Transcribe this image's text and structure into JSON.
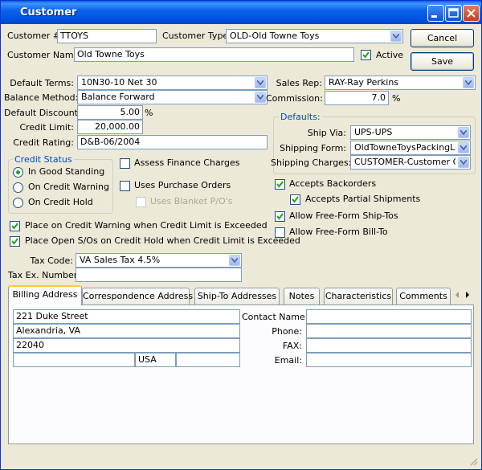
{
  "window": {
    "title": "Customer"
  },
  "header": {
    "customer_no_label": "Customer #:",
    "customer_no": "TTOYS",
    "customer_type_label": "Customer Type:",
    "customer_type": "OLD-Old Towne Toys",
    "customer_name_label": "Customer Name:",
    "customer_name": "Old Towne Toys",
    "active_label": "Active",
    "active": true
  },
  "buttons": {
    "cancel": "Cancel",
    "save": "Save"
  },
  "terms": {
    "default_terms_label": "Default Terms:",
    "default_terms": "10N30-10 Net 30",
    "balance_method_label": "Balance Method:",
    "balance_method": "Balance Forward",
    "default_discount_label": "Default Discount:",
    "default_discount": "5.00",
    "percent": "%",
    "credit_limit_label": "Credit Limit:",
    "credit_limit": "20,000.00",
    "credit_rating_label": "Credit Rating:",
    "credit_rating": "D&B-06/2004"
  },
  "sales": {
    "sales_rep_label": "Sales Rep:",
    "sales_rep": "RAY-Ray Perkins",
    "commission_label": "Commission:",
    "commission": "7.0",
    "percent": "%"
  },
  "defaults": {
    "title": "Defaults:",
    "ship_via_label": "Ship Via:",
    "ship_via": "UPS-UPS",
    "shipping_form_label": "Shipping Form:",
    "shipping_form": "OldTowneToysPackingList",
    "shipping_charges_label": "Shipping Charges:",
    "shipping_charges": "CUSTOMER-Customer Charge"
  },
  "credit_status": {
    "title": "Credit Status",
    "options": [
      "In Good Standing",
      "On Credit Warning",
      "On Credit Hold"
    ],
    "selected": 0
  },
  "options": {
    "assess_finance_charges": "Assess Finance Charges",
    "uses_purchase_orders": "Uses Purchase Orders",
    "uses_blanket_pos": "Uses Blanket P/O's",
    "accepts_backorders": "Accepts Backorders",
    "accepts_partial_shipments": "Accepts Partial Shipments",
    "allow_freeform_shipto": "Allow Free-Form Ship-Tos",
    "allow_freeform_billto": "Allow Free-Form Bill-To",
    "credit_warning_label": "Place on Credit Warning when Credit Limit is Exceeded",
    "credit_hold_label": "Place Open S/Os on Credit Hold when Credit Limit is Exceeded"
  },
  "tax": {
    "tax_code_label": "Tax Code:",
    "tax_code": "VA Sales Tax 4.5%",
    "tax_ex_label": "Tax Ex. Number:",
    "tax_ex": ""
  },
  "tabs": [
    "Billing Address",
    "Correspondence Address",
    "Ship-To Addresses",
    "Notes",
    "Characteristics",
    "Comments"
  ],
  "billing": {
    "line1": "221 Duke Street",
    "line2": "Alexandria, VA",
    "line3": "22040",
    "city": "",
    "country": "USA",
    "extra": "",
    "contact_name_label": "Contact Name:",
    "phone_label": "Phone:",
    "fax_label": "FAX:",
    "email_label": "Email:"
  },
  "colors": {
    "title_bar": "#0054e3",
    "group_title": "#0046d5",
    "check": "#21a121",
    "tab_highlight": "#ffc83c"
  }
}
